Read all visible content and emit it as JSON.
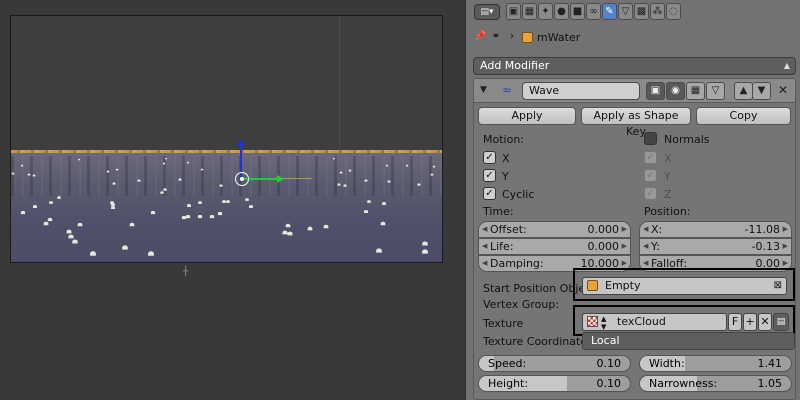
{
  "properties": {
    "breadcrumb": {
      "object_name": "mWater"
    },
    "add_modifier_label": "Add Modifier",
    "modifier": {
      "name": "Wave",
      "apply_label": "Apply",
      "apply_shape_label": "Apply as Shape Key",
      "copy_label": "Copy",
      "motion_label": "Motion:",
      "x_label": "X",
      "y_label": "Y",
      "cyclic_label": "Cyclic",
      "normals_label": "Normals",
      "nx_label": "X",
      "ny_label": "Y",
      "nz_label": "Z",
      "time_label": "Time:",
      "position_label": "Position:",
      "offset": {
        "label": "Offset:",
        "value": "0.000"
      },
      "life": {
        "label": "Life:",
        "value": "0.000"
      },
      "damping": {
        "label": "Damping:",
        "value": "10.000"
      },
      "pos_x": {
        "label": "X:",
        "value": "-11.08"
      },
      "pos_y": {
        "label": "Y:",
        "value": "-0.13"
      },
      "falloff": {
        "label": "Falloff:",
        "value": "0.00"
      },
      "start_position_label": "Start Position Object:",
      "start_position_value": "Empty",
      "vertex_group_label": "Vertex Group:",
      "texture_label": "Texture",
      "texture_value": "texCloud",
      "texture_f_label": "F",
      "texture_coords_label": "Texture Coordinates:",
      "texture_coords_value": "Local",
      "speed": {
        "label": "Speed:",
        "value": "0.10"
      },
      "height": {
        "label": "Height:",
        "value": "0.10"
      },
      "width": {
        "label": "Width:",
        "value": "1.41"
      },
      "narrowness": {
        "label": "Narrowness:",
        "value": "1.05"
      }
    }
  },
  "colors": {
    "active_tab": "#5682c8",
    "highlight_box": "#000000",
    "z_axis": "#2233dd",
    "x_axis": "#22cc33",
    "horizon": "#c8964a"
  },
  "icons": {
    "tabs": [
      "render-icon",
      "render-layers-icon",
      "scene-icon",
      "world-icon",
      "object-icon",
      "constraints-icon",
      "modifiers-icon",
      "data-icon",
      "texture-icon",
      "particles-icon",
      "physics-icon"
    ]
  }
}
